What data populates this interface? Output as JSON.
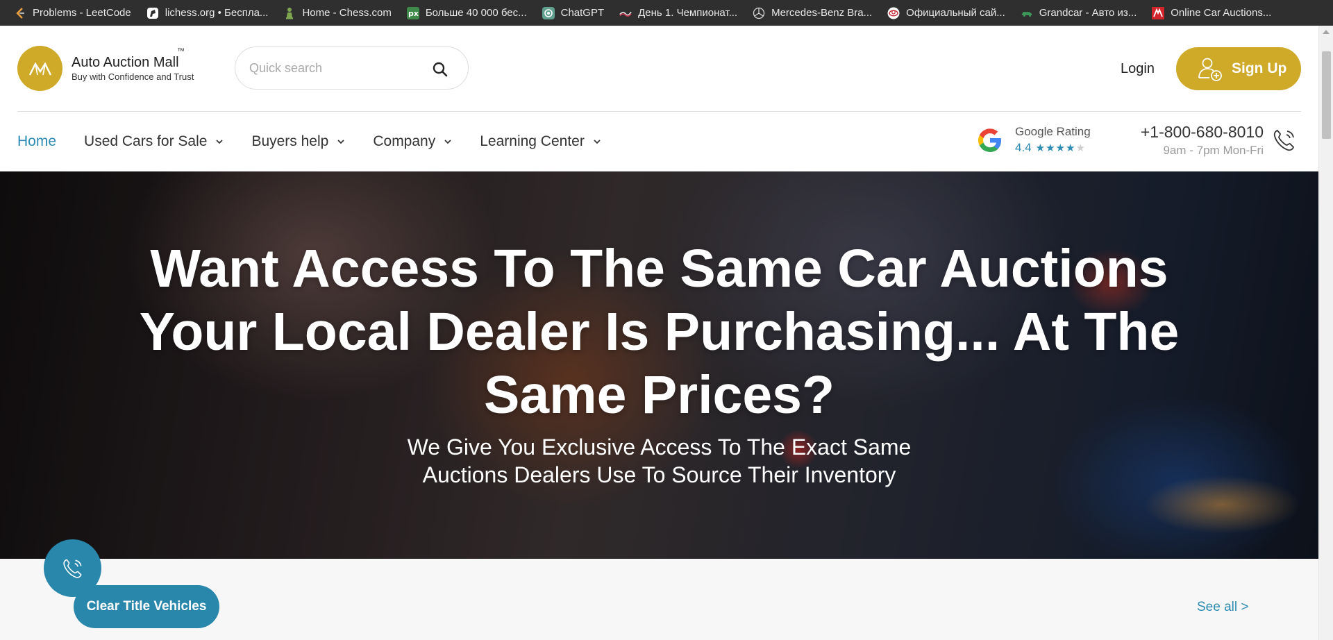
{
  "bookmarks": [
    {
      "label": "Problems - LeetCode",
      "icon": "leetcode-icon"
    },
    {
      "label": "lichess.org • Беспла...",
      "icon": "lichess-icon"
    },
    {
      "label": "Home - Chess.com",
      "icon": "chess-pawn-icon"
    },
    {
      "label": "Больше 40 000 бес...",
      "icon": "px-icon"
    },
    {
      "label": "ChatGPT",
      "icon": "chatgpt-icon"
    },
    {
      "label": "День 1. Чемпионат...",
      "icon": "flag-icon"
    },
    {
      "label": "Mercedes-Benz Bra...",
      "icon": "mercedes-icon"
    },
    {
      "label": "Официальный сай...",
      "icon": "toyota-icon"
    },
    {
      "label": "Grandcar - Авто из...",
      "icon": "car-icon"
    },
    {
      "label": "Online Car Auctions...",
      "icon": "auction-mall-icon"
    }
  ],
  "header": {
    "logo_name": "Auto Auction Mall",
    "logo_tm": "™",
    "logo_tagline": "Buy with Confidence and Trust",
    "search_placeholder": "Quick search",
    "login_label": "Login",
    "signup_label": "Sign Up"
  },
  "nav": {
    "items": [
      {
        "label": "Home",
        "active": true,
        "dropdown": false
      },
      {
        "label": "Used Cars for Sale",
        "dropdown": true
      },
      {
        "label": "Buyers help",
        "dropdown": true
      },
      {
        "label": "Company",
        "dropdown": true
      },
      {
        "label": "Learning Center",
        "dropdown": true
      }
    ]
  },
  "rating": {
    "label": "Google Rating",
    "value": "4.4",
    "stars_full": 4,
    "stars_total": 5
  },
  "phone": {
    "number": "+1-800-680-8010",
    "hours": "9am - 7pm Mon-Fri"
  },
  "hero": {
    "title": "Want Access To The Same Car Auctions Your Local Dealer Is Purchasing... At The Same Prices?",
    "subtitle_line1": "We Give You Exclusive Access To The Exact Same",
    "subtitle_line2": "Auctions Dealers Use To Source Their Inventory"
  },
  "bottom": {
    "pill_label": "Clear Title Vehicles",
    "see_all_label": "See all >"
  },
  "colors": {
    "brand_gold": "#cfa928",
    "accent_blue": "#2d8cb3",
    "bookmarks_bg": "#2f2f2f"
  }
}
